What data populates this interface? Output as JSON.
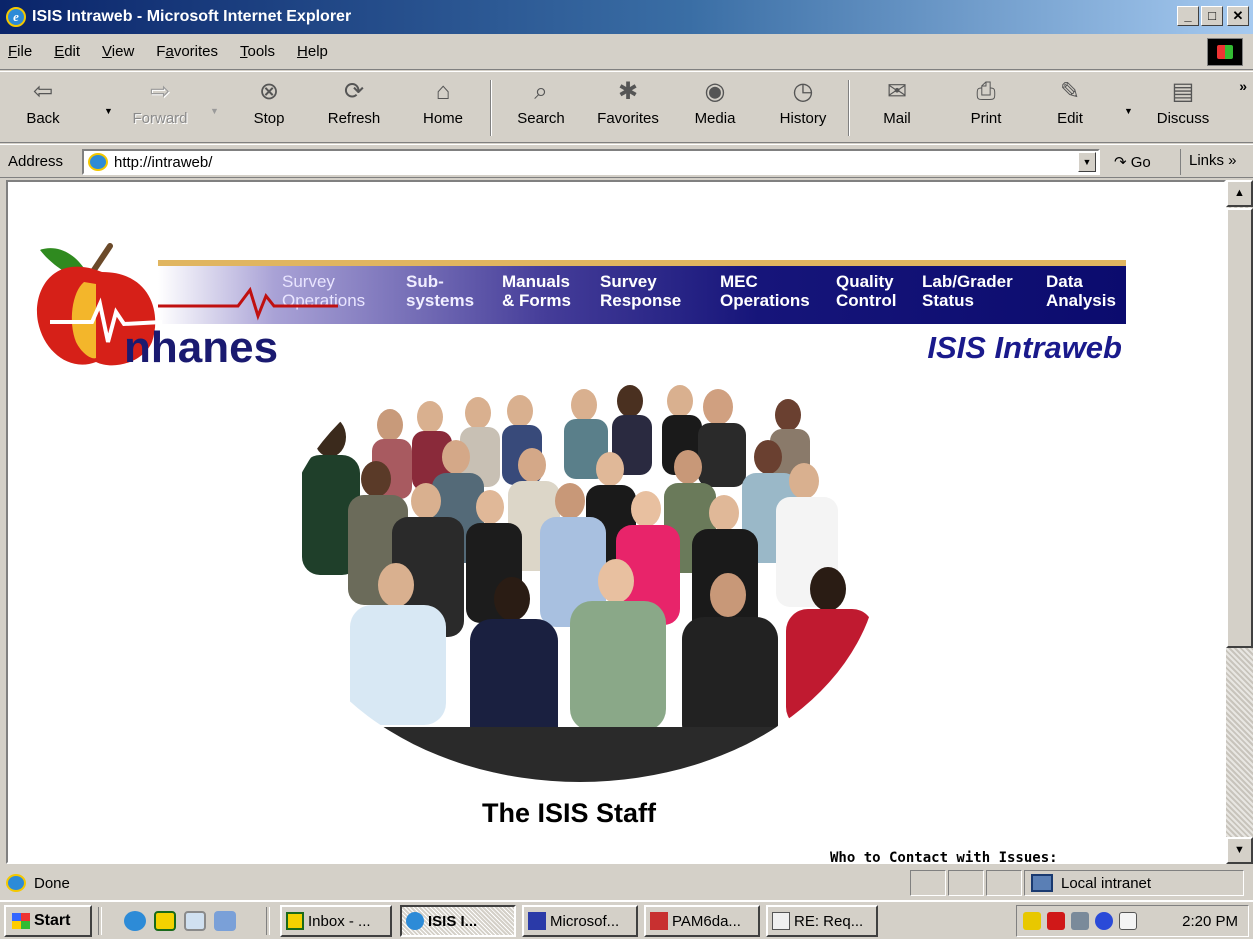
{
  "window": {
    "title": "ISIS Intraweb - Microsoft Internet Explorer",
    "controls": [
      "_",
      "□",
      "✕"
    ]
  },
  "menu": [
    {
      "label": "File",
      "key": "F",
      "rest": "ile"
    },
    {
      "label": "Edit",
      "key": "E",
      "rest": "dit"
    },
    {
      "label": "View",
      "key": "V",
      "rest": "iew"
    },
    {
      "label": "Favorites",
      "pre": "F",
      "key": "a",
      "rest": "vorites"
    },
    {
      "label": "Tools",
      "key": "T",
      "rest": "ools"
    },
    {
      "label": "Help",
      "key": "H",
      "rest": "elp"
    }
  ],
  "toolbar": {
    "back": "Back",
    "forward": "Forward",
    "stop": "Stop",
    "refresh": "Refresh",
    "home": "Home",
    "search": "Search",
    "favorites": "Favorites",
    "media": "Media",
    "history": "History",
    "mail": "Mail",
    "print": "Print",
    "edit": "Edit",
    "discuss": "Discuss",
    "more": "»"
  },
  "address": {
    "label": "Address",
    "url": "http://intraweb/",
    "go": "Go",
    "links": "Links »"
  },
  "page": {
    "logo_text": "nhanes",
    "nav": [
      {
        "line1": "Survey",
        "line2": "Operations"
      },
      {
        "line1": "Sub-",
        "line2": "systems"
      },
      {
        "line1": "Manuals",
        "line2": "& Forms"
      },
      {
        "line1": "Survey",
        "line2": "Response"
      },
      {
        "line1": "MEC",
        "line2": "Operations"
      },
      {
        "line1": "Quality",
        "line2": "Control"
      },
      {
        "line1": "Lab/Grader",
        "line2": "Status"
      },
      {
        "line1": "Data",
        "line2": "Analysis"
      }
    ],
    "site_title": "ISIS Intraweb",
    "photo_caption": "The ISIS Staff",
    "contact_heading": "Who to Contact with Issues:"
  },
  "status": {
    "text": "Done",
    "zone": "Local intranet"
  },
  "taskbar": {
    "start": "Start",
    "tasks": [
      {
        "label": "Inbox - ...",
        "active": false
      },
      {
        "label": "ISIS I...",
        "active": true
      },
      {
        "label": "Microsof...",
        "active": false
      },
      {
        "label": "PAM6da...",
        "active": false
      },
      {
        "label": "RE: Req...",
        "active": false
      }
    ],
    "clock": "2:20 PM"
  },
  "colors": {
    "title_bar": "#0a246a",
    "nav_band": "#16157a",
    "site_title": "#1a1a8c",
    "chrome": "#d4d0c8"
  }
}
